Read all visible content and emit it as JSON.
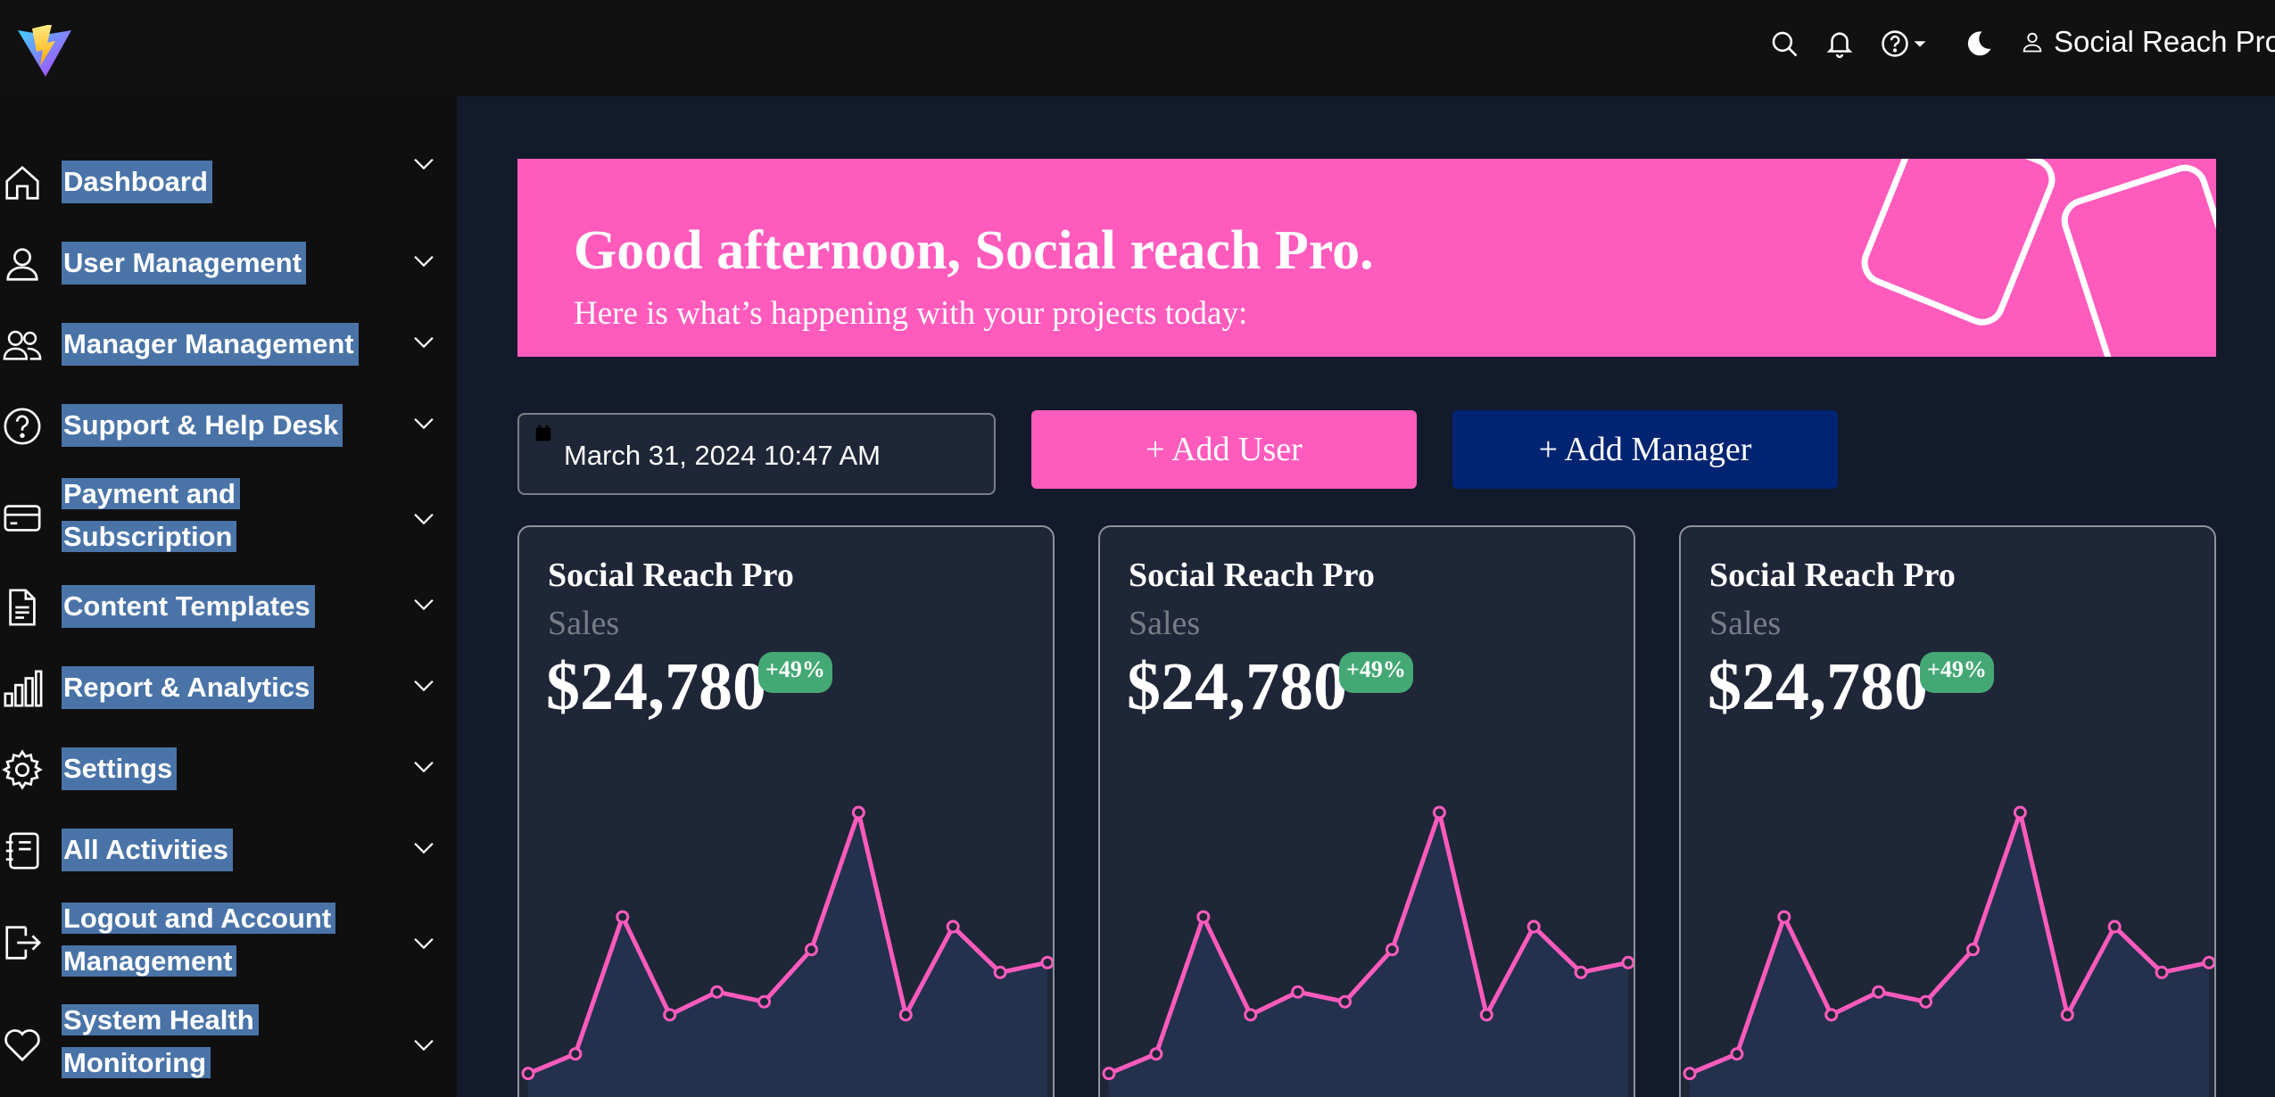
{
  "header": {
    "user_name": "Social Reach Pro",
    "icons": [
      "search-icon",
      "bell-icon",
      "help-icon",
      "moon-icon",
      "user-icon"
    ]
  },
  "sidebar": {
    "items": [
      {
        "label": "Dashboard",
        "icon": "home-icon"
      },
      {
        "label": "User Management",
        "icon": "user-icon"
      },
      {
        "label": "Manager Management",
        "icon": "users-icon"
      },
      {
        "label": "Support & Help Desk",
        "icon": "help-circle-icon"
      },
      {
        "label_line1": "Payment and",
        "label_line2": "Subscription",
        "icon": "credit-card-icon"
      },
      {
        "label": "Content Templates",
        "icon": "document-icon"
      },
      {
        "label": "Report & Analytics",
        "icon": "bar-chart-icon"
      },
      {
        "label": "Settings",
        "icon": "gear-icon"
      },
      {
        "label": "All Activities",
        "icon": "notebook-icon"
      },
      {
        "label_line1": "Logout and Account",
        "label_line2": "Management",
        "icon": "logout-icon"
      },
      {
        "label_line1": "System Health",
        "label_line2": "Monitoring",
        "icon": "heart-icon"
      }
    ]
  },
  "banner": {
    "title": "Good afternoon, Social reach Pro.",
    "subtitle": "Here is what’s happening with your projects today:"
  },
  "date_display": "March 31, 2024 10:47 AM",
  "buttons": {
    "add_user": "+ Add User",
    "add_manager": "+ Add Manager"
  },
  "cards": [
    {
      "title": "Social Reach Pro",
      "subtitle": "Sales",
      "value": "$24,780",
      "badge": "+49%"
    },
    {
      "title": "Social Reach Pro",
      "subtitle": "Sales",
      "value": "$24,780",
      "badge": "+49%"
    },
    {
      "title": "Social Reach Pro",
      "subtitle": "Sales",
      "value": "$24,780",
      "badge": "+49%"
    }
  ],
  "chart_data": [
    {
      "type": "area",
      "values": [
        2,
        8,
        50,
        20,
        27,
        24,
        40,
        82,
        20,
        47,
        33,
        36
      ]
    },
    {
      "type": "area",
      "values": [
        2,
        8,
        50,
        20,
        27,
        24,
        40,
        82,
        20,
        47,
        33,
        36
      ]
    },
    {
      "type": "area",
      "values": [
        2,
        8,
        50,
        20,
        27,
        24,
        40,
        82,
        20,
        47,
        33,
        36
      ]
    }
  ],
  "colors": {
    "accent_pink": "#ff5bbd",
    "navy_button": "#002472",
    "badge_green": "#44a874",
    "sidebar_highlight": "#4a74a8",
    "card_background": "#1f2637",
    "main_background": "#131a2b"
  }
}
